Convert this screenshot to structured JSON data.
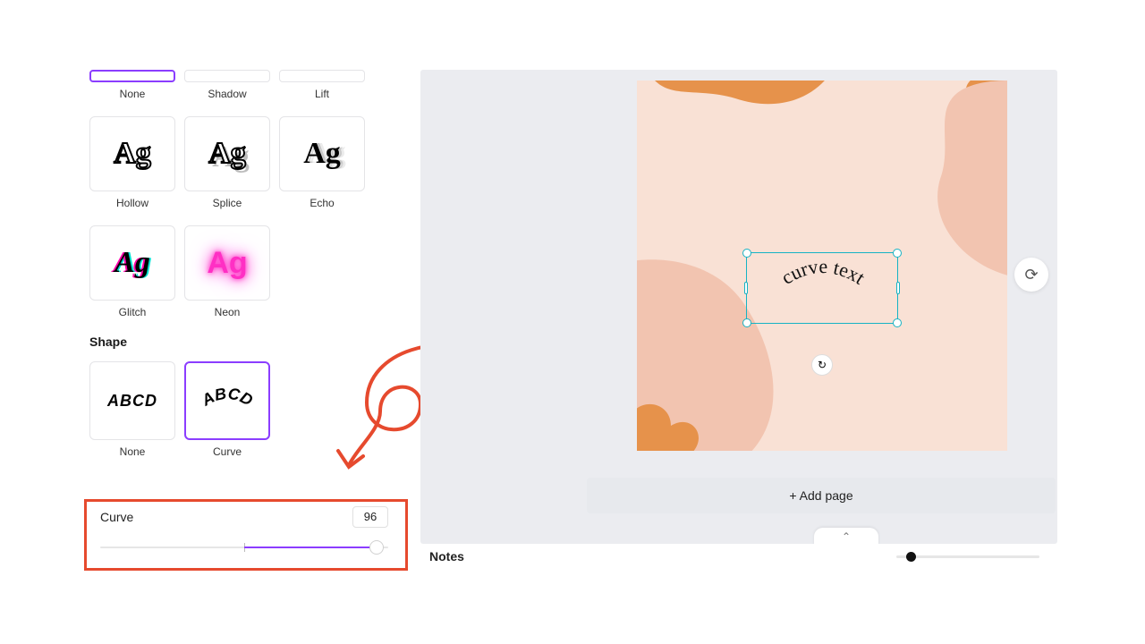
{
  "effects_row1": [
    {
      "id": "none",
      "label": "None",
      "selected": true
    },
    {
      "id": "shadow",
      "label": "Shadow",
      "selected": false
    },
    {
      "id": "lift",
      "label": "Lift",
      "selected": false
    }
  ],
  "effects_row2": [
    {
      "id": "hollow",
      "label": "Hollow",
      "sample": "Ag"
    },
    {
      "id": "splice",
      "label": "Splice",
      "sample": "Ag"
    },
    {
      "id": "echo",
      "label": "Echo",
      "sample": "Ag"
    }
  ],
  "effects_row3": [
    {
      "id": "glitch",
      "label": "Glitch",
      "sample": "Ag"
    },
    {
      "id": "neon",
      "label": "Neon",
      "sample": "Ag"
    }
  ],
  "shape": {
    "title": "Shape",
    "options": [
      {
        "id": "none",
        "label": "None",
        "sample": "ABCD",
        "selected": false
      },
      {
        "id": "curve",
        "label": "Curve",
        "sample": "ABCD",
        "selected": true
      }
    ]
  },
  "curve_slider": {
    "label": "Curve",
    "value": "96"
  },
  "canvas": {
    "text": "curve text",
    "add_page_label": "+ Add page"
  },
  "bottom": {
    "notes_label": "Notes"
  },
  "colors": {
    "accent": "#8b3dff",
    "highlight": "#e64a2e",
    "selection": "#16b3c4"
  }
}
